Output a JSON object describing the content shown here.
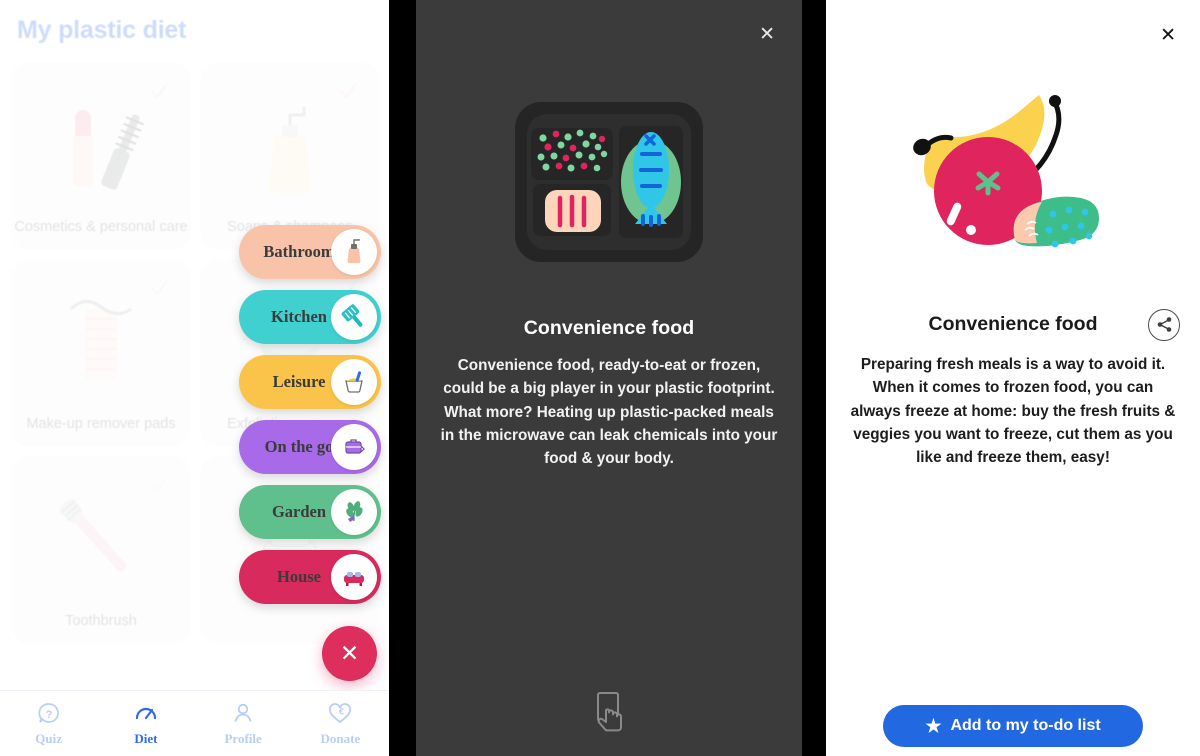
{
  "left_panel": {
    "title": "My plastic diet",
    "cards": [
      {
        "label": "Cosmetics & personal care",
        "art": "lipstick-mascara-icon"
      },
      {
        "label": "Soaps & shampoos",
        "art": "soap-dispenser-icon"
      },
      {
        "label": "Make-up remover pads",
        "art": "cotton-pads-icon"
      },
      {
        "label": "Exfoliating sponges",
        "art": "sponge-icon"
      },
      {
        "label": "Toothbrush",
        "art": "toothbrush-icon"
      },
      {
        "label": "",
        "art": "cream-jar-icon"
      }
    ],
    "pills": [
      {
        "label": "Bathroom",
        "color": "#f8c3a8",
        "icon": "soap-bottle-icon",
        "glyph": "🧴"
      },
      {
        "label": "Kitchen",
        "color": "#3fd0cf",
        "icon": "spatula-icon",
        "glyph": "🥄"
      },
      {
        "label": "Leisure",
        "color": "#fac349",
        "icon": "paint-bucket-icon",
        "glyph": "🎨"
      },
      {
        "label": "On the go",
        "color": "#a86ae8",
        "icon": "suitcase-icon",
        "glyph": "💼"
      },
      {
        "label": "Garden",
        "color": "#5fc08e",
        "icon": "plant-icon",
        "glyph": "🌿"
      },
      {
        "label": "House",
        "color": "#d82a5c",
        "icon": "sofa-icon",
        "glyph": "🛋️"
      }
    ],
    "fab": {
      "icon": "close-icon",
      "glyph": "✕",
      "color": "#dd2e5e"
    },
    "tabs": [
      {
        "label": "Quiz",
        "icon": "question-bubble-icon",
        "active": false
      },
      {
        "label": "Diet",
        "icon": "gauge-icon",
        "active": true
      },
      {
        "label": "Profile",
        "icon": "person-icon",
        "active": false
      },
      {
        "label": "Donate",
        "icon": "heart-euro-icon",
        "active": false
      }
    ],
    "accent": "#5b8cf7"
  },
  "mid_panel": {
    "close_icon": "close-icon",
    "close_glyph": "✕",
    "art": "convenience-food-tray-illustration",
    "title": "Convenience food",
    "body": "Convenience food, ready-to-eat or frozen, could be a big player in your plastic footprint. What more? Heating up plastic-packed meals in the microwave can leak chemicals into your food & your body.",
    "swipe_hint_icon": "swipe-hand-icon",
    "background": "#3b3b3b"
  },
  "right_panel": {
    "close_icon": "close-icon",
    "close_glyph": "✕",
    "art": "fresh-fruit-veggies-illustration",
    "title": "Convenience food",
    "share_icon": "share-icon",
    "body": "Preparing fresh meals is a way to avoid it. When it comes to frozen food, you can always freeze at home: buy the fresh fruits & veggies you want to freeze, cut them as you like and freeze them, easy!",
    "cta": {
      "label": "Add to my to-do list",
      "icon": "star-icon",
      "glyph": "★",
      "color": "#2268e0"
    }
  }
}
